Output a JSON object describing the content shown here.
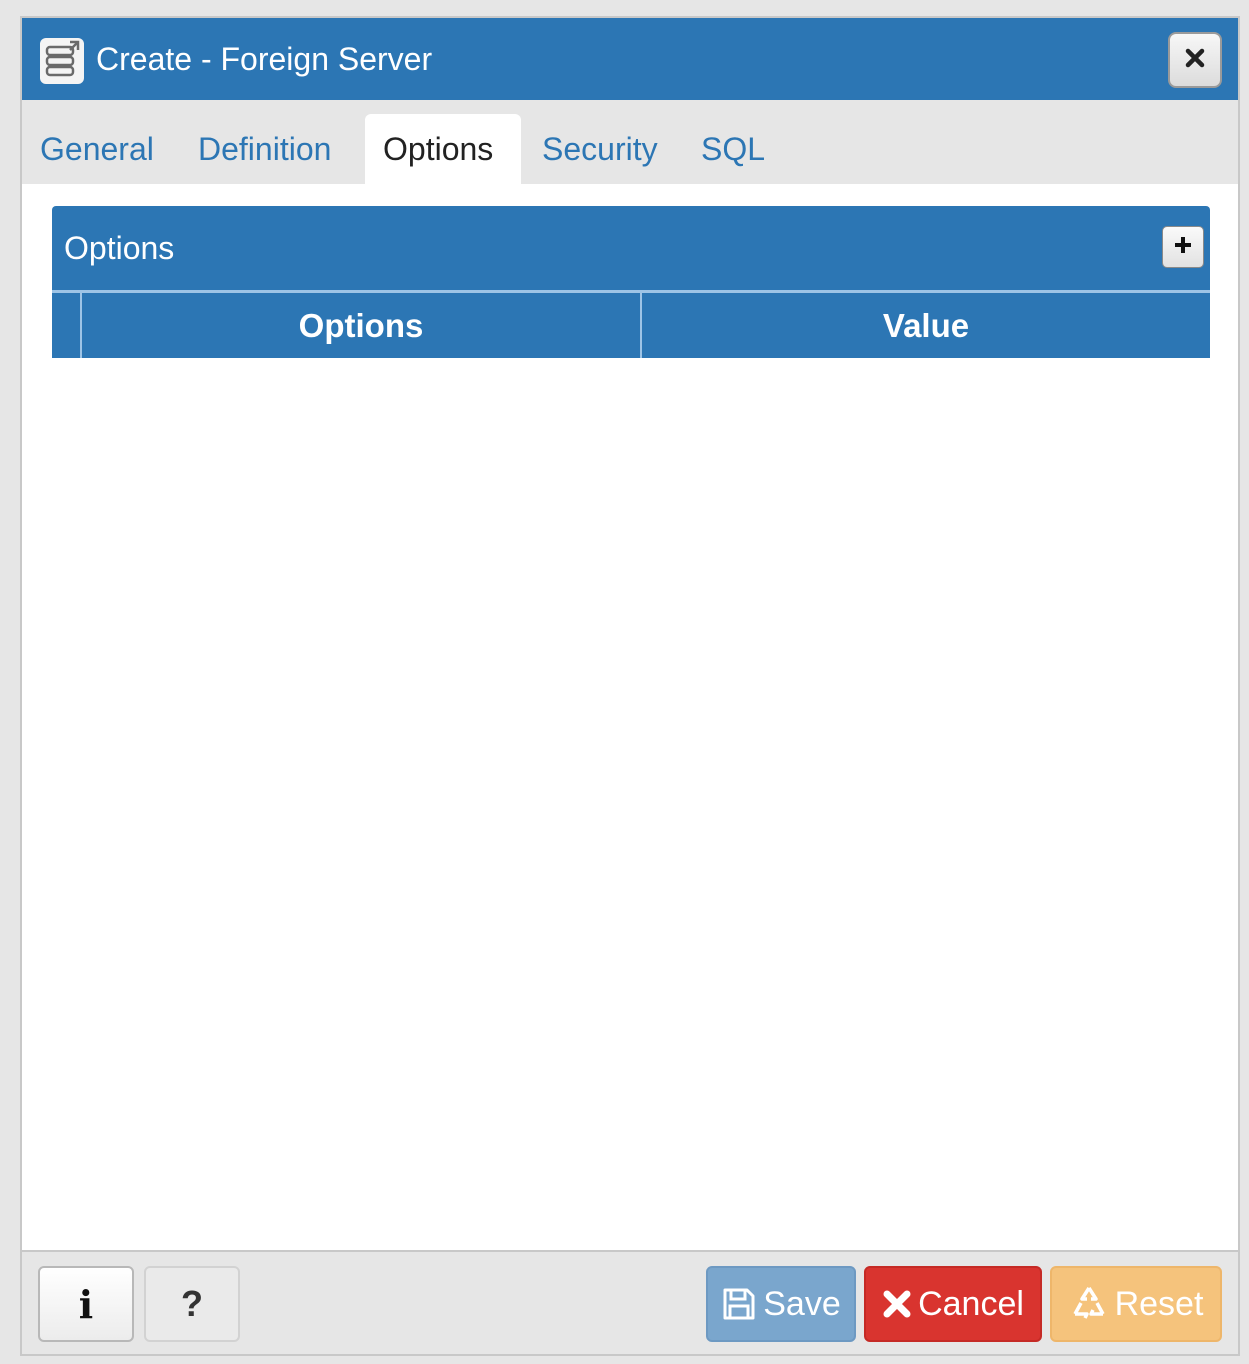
{
  "dialog": {
    "title": "Create - Foreign Server",
    "title_icon": "foreign-server-icon",
    "close_icon": "close-icon"
  },
  "tabs": [
    {
      "label": "General",
      "active": false
    },
    {
      "label": "Definition",
      "active": false
    },
    {
      "label": "Options",
      "active": true
    },
    {
      "label": "Security",
      "active": false
    },
    {
      "label": "SQL",
      "active": false
    }
  ],
  "options_panel": {
    "title": "Options",
    "add_icon": "plus-icon",
    "columns": [
      "Options",
      "Value"
    ],
    "rows": []
  },
  "footer": {
    "info_label": "i",
    "help_label": "?",
    "save_label": "Save",
    "cancel_label": "Cancel",
    "reset_label": "Reset"
  },
  "colors": {
    "accent": "#2c76b4",
    "save": "#7aa6cd",
    "cancel": "#d9342f",
    "reset": "#f5c37c"
  }
}
